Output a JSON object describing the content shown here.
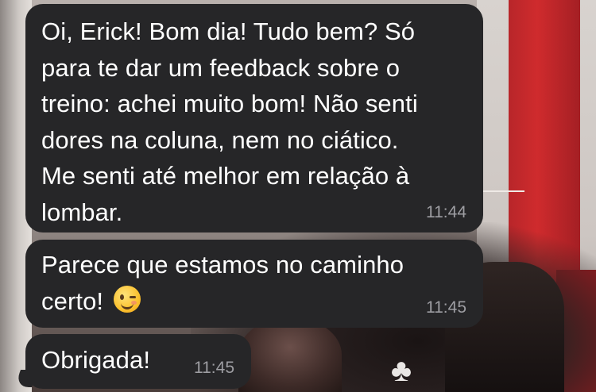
{
  "messages": [
    {
      "text_lines": [
        "Oi, Erick! Bom dia! Tudo bem? Só",
        "para te dar um feedback sobre o",
        "treino: achei muito bom! Não senti",
        "dores na coluna, nem no ciático.",
        "Me senti até melhor em relação à",
        "lombar."
      ],
      "time": "11:44"
    },
    {
      "text_lines": [
        "Parece que estamos no caminho",
        "certo!"
      ],
      "emoji": "winking-face-emoji",
      "time": "11:45"
    },
    {
      "text_lines": [
        "Obrigada!"
      ],
      "time": "11:45"
    }
  ],
  "colors": {
    "bubble": "#262628",
    "text": "#ffffff",
    "timestamp": "#9e9ea3"
  }
}
